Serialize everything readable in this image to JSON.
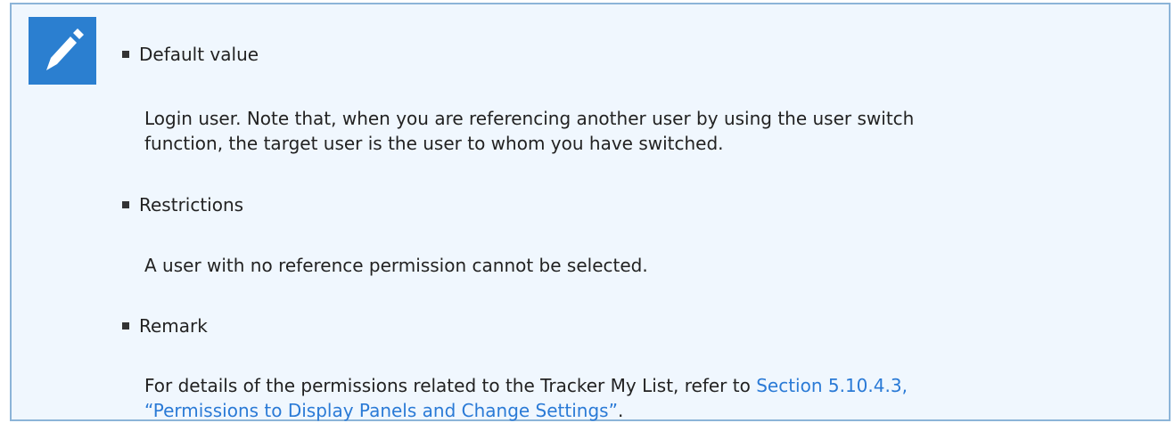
{
  "note": {
    "icon": "pencil-icon",
    "icon_bg": "#2b7fd0",
    "box_bg": "#f0f7fe",
    "box_border": "#8cb4d8",
    "link_color": "#2a7ad6",
    "default_value": {
      "heading": "Default value",
      "line1": "Login user. Note that, when you are referencing another user by using the user switch",
      "line2": "function, the target user is the user to whom you have switched."
    },
    "restrictions": {
      "heading": "Restrictions",
      "text": "A user with no reference permission cannot be selected."
    },
    "remark": {
      "heading": "Remark",
      "line1_prefix": "For details of the permissions related to the Tracker My List, refer to ",
      "link_line1": "Section 5.10.4.3,",
      "link_line2": "“Permissions to Display Panels and Change Settings”",
      "line2_suffix": "."
    }
  }
}
